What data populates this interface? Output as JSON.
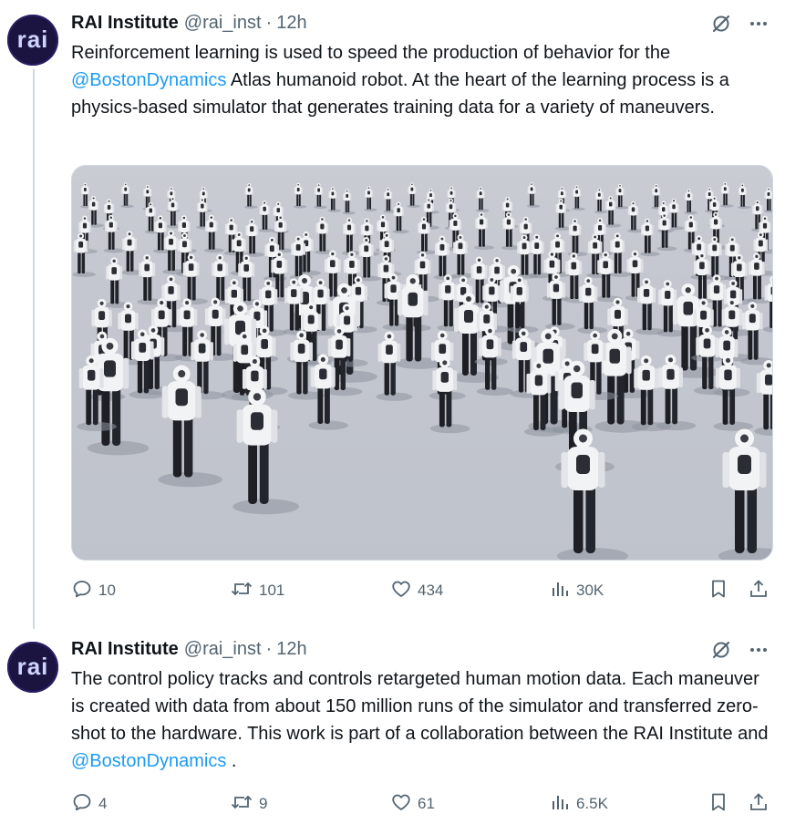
{
  "tweets": [
    {
      "avatar_text": "rai",
      "name": "RAI Institute",
      "handle": "@rai_inst",
      "separator": "·",
      "time": "12h",
      "text_segments": [
        {
          "text": "Reinforcement learning is used to speed the production of behavior for the ",
          "mention": false
        },
        {
          "text": "@BostonDynamics",
          "mention": true
        },
        {
          "text": " Atlas humanoid robot.  At the heart of the learning process is a physics-based simulator that generates training data for a variety of maneuvers.",
          "mention": false
        }
      ],
      "media_alt": "Simulated Atlas humanoid robots walking on a grey floor",
      "stats": {
        "replies": "10",
        "reposts": "101",
        "likes": "434",
        "views": "30K"
      }
    },
    {
      "avatar_text": "rai",
      "name": "RAI Institute",
      "handle": "@rai_inst",
      "separator": "·",
      "time": "12h",
      "text_segments": [
        {
          "text": "The control policy tracks and controls retargeted human motion data.  Each maneuver is created with data from about 150 million runs of the simulator and transferred zero-shot to the hardware. This work is part of a collaboration between the RAI Institute and ",
          "mention": false
        },
        {
          "text": "@BostonDynamics",
          "mention": true
        },
        {
          "text": " .",
          "mention": false
        }
      ],
      "stats": {
        "replies": "4",
        "reposts": "9",
        "likes": "61",
        "views": "6.5K"
      }
    }
  ],
  "colors": {
    "accent": "#1d9bf0",
    "muted": "#536471",
    "text": "#0f1419",
    "avatar_bg": "#1b1440"
  },
  "icons": [
    "grok-icon",
    "more-icon",
    "reply-icon",
    "repost-icon",
    "like-icon",
    "views-icon",
    "bookmark-icon",
    "share-icon"
  ]
}
